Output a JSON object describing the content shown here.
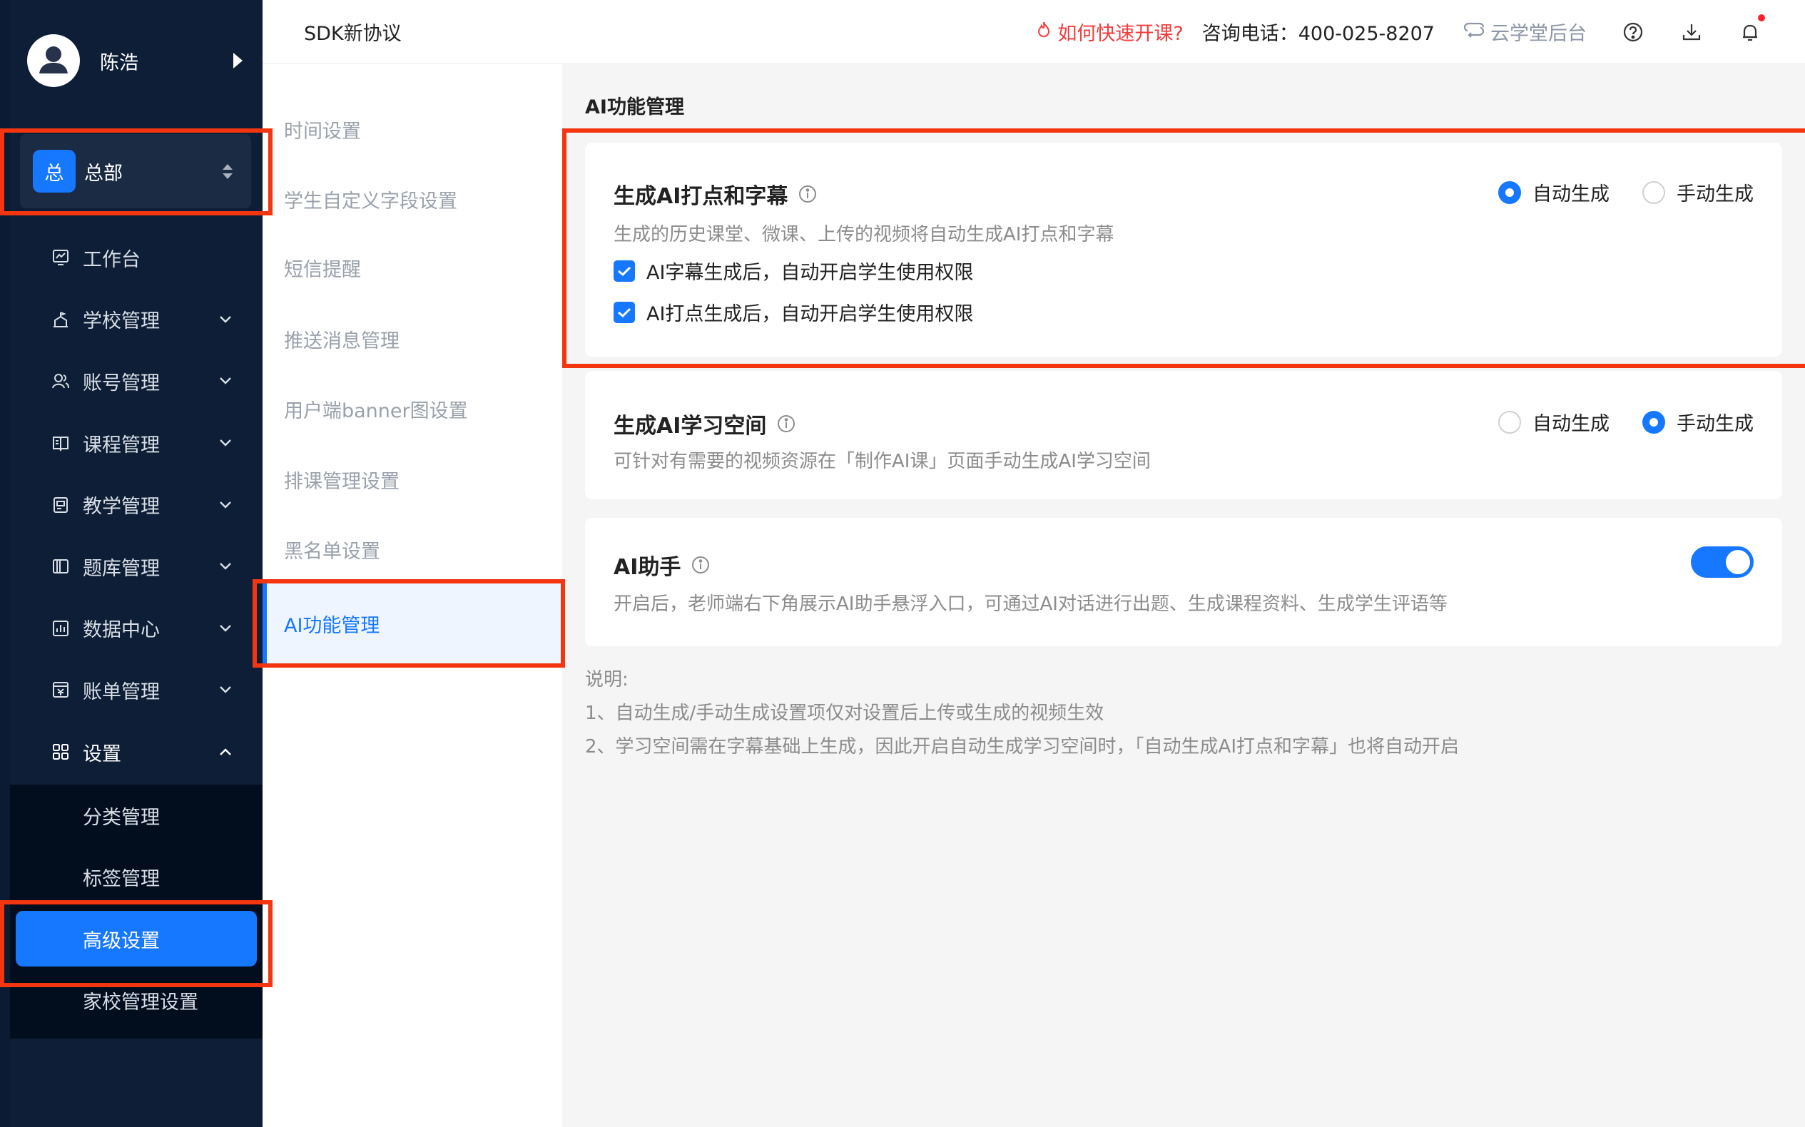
{
  "user": {
    "name": "陈浩"
  },
  "org": {
    "badge": "总",
    "name": "总部"
  },
  "nav": {
    "items": [
      {
        "label": "工作台",
        "icon": "dashboard-icon",
        "expandable": false
      },
      {
        "label": "学校管理",
        "icon": "school-icon",
        "expandable": true
      },
      {
        "label": "账号管理",
        "icon": "users-icon",
        "expandable": true
      },
      {
        "label": "课程管理",
        "icon": "book-icon",
        "expandable": true
      },
      {
        "label": "教学管理",
        "icon": "teaching-icon",
        "expandable": true
      },
      {
        "label": "题库管理",
        "icon": "question-bank-icon",
        "expandable": true
      },
      {
        "label": "数据中心",
        "icon": "chart-icon",
        "expandable": true
      },
      {
        "label": "账单管理",
        "icon": "bill-icon",
        "expandable": true
      },
      {
        "label": "设置",
        "icon": "grid-icon",
        "expandable": true,
        "expanded": true
      }
    ],
    "sub_items": [
      "分类管理",
      "标签管理",
      "高级设置",
      "家校管理设置"
    ],
    "active_sub": "高级设置"
  },
  "header": {
    "title": "SDK新协议",
    "hot_link": "如何快速开课?",
    "phone": "咨询电话：400-025-8207",
    "backend": "云学堂后台"
  },
  "submenu": {
    "items": [
      "时间设置",
      "学生自定义字段设置",
      "短信提醒",
      "推送消息管理",
      "用户端banner图设置",
      "排课管理设置",
      "黑名单设置",
      "AI功能管理"
    ],
    "active": "AI功能管理"
  },
  "main": {
    "section_title": "AI功能管理",
    "cards": {
      "ai_subtitles": {
        "title": "生成AI打点和字幕",
        "desc": "生成的历史课堂、微课、上传的视频将自动生成AI打点和字幕",
        "option_auto": "自动生成",
        "option_manual": "手动生成",
        "selected": "auto",
        "check1": "AI字幕生成后，自动开启学生使用权限",
        "check2": "AI打点生成后，自动开启学生使用权限"
      },
      "ai_space": {
        "title": "生成AI学习空间",
        "desc": "可针对有需要的视频资源在「制作AI课」页面手动生成AI学习空间",
        "option_auto": "自动生成",
        "option_manual": "手动生成",
        "selected": "manual"
      },
      "ai_assistant": {
        "title": "AI助手",
        "desc": "开启后，老师端右下角展示AI助手悬浮入口，可通过AI对话进行出题、生成课程资料、生成学生评语等",
        "enabled": true
      }
    },
    "notes": {
      "heading": "说明:",
      "line1": "1、自动生成/手动生成设置项仅对设置后上传或生成的视频生效",
      "line2": "2、学习空间需在字幕基础上生成，因此开启自动生成学习空间时，「自动生成AI打点和字幕」也将自动开启"
    }
  },
  "colors": {
    "accent": "#1677ff",
    "highlight": "#f3360f",
    "sidebar": "#0d1e36",
    "hot": "#f23c3c"
  }
}
